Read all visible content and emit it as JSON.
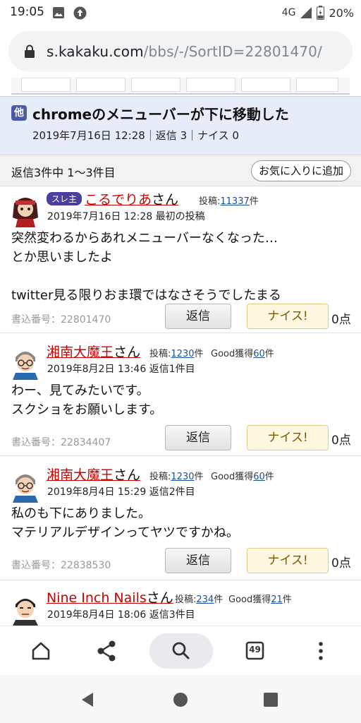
{
  "status_bar": {
    "time": "19:05",
    "network": "4G",
    "battery": "20%"
  },
  "browser": {
    "url_host": "s.kakaku.com",
    "url_path": "/bbs/-/SortID=22801470/",
    "tabs_count": "49"
  },
  "thread": {
    "category_badge": "他",
    "title": "chromeのメニューバーが下に移動した",
    "meta": "2019年7月16日 12:28｜返信 3｜ナイス 0"
  },
  "reply_range": "返信3件中 1～3件目",
  "favorite_button": "お気に入りに追加",
  "posts": [
    {
      "thread_starter_badge": "スレ主",
      "username": "こるでりあ",
      "suffix": "さん",
      "posts_label": "投稿:",
      "posts_count": "11337",
      "posts_unit": "件",
      "date": "2019年7月16日 12:28 最初の投稿",
      "body": "突然変わるからあれメニューバーなくなった…\nとか思いましたよ\n\ntwitter見る限りおま環ではなさそうでしたまる",
      "post_no": "書込番号：22801470",
      "reply_label": "返信",
      "nice_label": "ナイス!",
      "nice_count": "0点"
    },
    {
      "username": "湘南大魔王",
      "suffix": "さん",
      "posts_label": "投稿:",
      "posts_count": "1230",
      "posts_unit": "件",
      "good_label": "Good獲得",
      "good_count": "60",
      "good_unit": "件",
      "date": "2019年8月2日 13:46 返信1件目",
      "body": "わー、見てみたいです。\nスクショをお願いします。",
      "post_no": "書込番号：22834407",
      "reply_label": "返信",
      "nice_label": "ナイス!",
      "nice_count": "0点"
    },
    {
      "username": "湘南大魔王",
      "suffix": "さん",
      "posts_label": "投稿:",
      "posts_count": "1230",
      "posts_unit": "件",
      "good_label": "Good獲得",
      "good_count": "60",
      "good_unit": "件",
      "date": "2019年8月4日 15:29 返信2件目",
      "body": "私のも下にありました。\nマテリアルデザインってヤツですかね。",
      "post_no": "書込番号：22838530",
      "reply_label": "返信",
      "nice_label": "ナイス!",
      "nice_count": "0点"
    },
    {
      "username": "Nine Inch Nails",
      "suffix": "さん",
      "posts_label": "投稿:",
      "posts_count": "234",
      "posts_unit": "件",
      "good_label": "Good獲得",
      "good_count": "21",
      "good_unit": "件",
      "date": "2019年8月4日 18:06 返信3件目"
    }
  ],
  "icons": {
    "status": [
      "image-icon",
      "upload-icon",
      "signal-icon",
      "battery-icon"
    ],
    "toolbar": [
      "home-icon",
      "share-icon",
      "search-icon",
      "tabs-icon",
      "more-icon"
    ],
    "nav": [
      "back-icon",
      "home-circle-icon",
      "recents-icon"
    ]
  },
  "colors": {
    "username": "#c00000",
    "link": "#1a4f9e",
    "title_band": "#e6ecf8",
    "nice_bg": "#fff7e0"
  }
}
